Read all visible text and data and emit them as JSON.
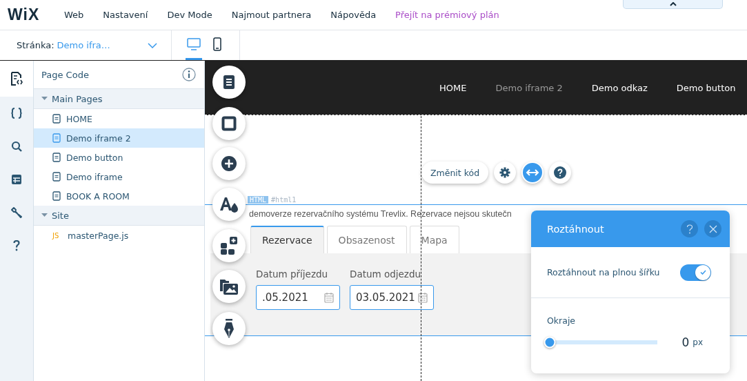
{
  "menu_bar": {
    "logo": "WiX",
    "items": [
      {
        "label": "Web",
        "kind": "normal"
      },
      {
        "label": "Nastavení",
        "kind": "normal"
      },
      {
        "label": "Dev Mode",
        "kind": "normal"
      },
      {
        "label": "Najmout partnera",
        "kind": "normal"
      },
      {
        "label": "Nápověda",
        "kind": "normal"
      },
      {
        "label": "Přejít na prémiový plán",
        "kind": "premium"
      }
    ]
  },
  "page_bar": {
    "label": "Stránka:",
    "page": "Demo ifra…",
    "views": [
      {
        "kind": "desktop",
        "selected": true
      },
      {
        "kind": "mobile",
        "selected": false
      }
    ]
  },
  "side_rail": [
    {
      "kind": "page-code",
      "selected": true
    },
    {
      "kind": "braces",
      "selected": false
    },
    {
      "kind": "search",
      "selected": false
    },
    {
      "kind": "database",
      "selected": false
    },
    {
      "kind": "tools",
      "selected": false
    },
    {
      "kind": "help",
      "selected": false
    }
  ],
  "code_panel": {
    "title": "Page Code",
    "sections": [
      {
        "label": "Main Pages",
        "expanded": true,
        "children": [
          {
            "label": "HOME",
            "kind": "page",
            "selected": false
          },
          {
            "label": "Demo iframe 2",
            "kind": "page",
            "selected": true
          },
          {
            "label": "Demo button",
            "kind": "page",
            "selected": false
          },
          {
            "label": "Demo iframe",
            "kind": "page",
            "selected": false
          },
          {
            "label": "BOOK A ROOM",
            "kind": "page",
            "selected": false
          }
        ]
      },
      {
        "label": "Site",
        "expanded": true,
        "children": [
          {
            "label": "masterPage.js",
            "kind": "js",
            "badge": "JS",
            "selected": false
          }
        ]
      }
    ]
  },
  "canvas": {
    "site_nav": [
      {
        "label": "HOME",
        "selected": false
      },
      {
        "label": "Demo iframe 2",
        "selected": true
      },
      {
        "label": "Demo odkaz",
        "selected": false
      },
      {
        "label": "Demo button",
        "selected": false
      }
    ],
    "tool_buttons": [
      {
        "kind": "pages"
      },
      {
        "kind": "box"
      },
      {
        "kind": "add"
      },
      {
        "kind": "design"
      },
      {
        "kind": "apps"
      },
      {
        "kind": "media"
      },
      {
        "kind": "pen"
      }
    ],
    "element_toolbar": {
      "edit_code": "Změnit kód",
      "buttons": [
        {
          "kind": "settings",
          "selected": false
        },
        {
          "kind": "stretch",
          "selected": true
        },
        {
          "kind": "help",
          "selected": false
        }
      ]
    },
    "element_label": {
      "type": "HTML",
      "id": "#html1"
    },
    "html_embed": {
      "intro": "demoverze rezervačního systému Trevlix. Rezervace nejsou skutečn",
      "tabs": [
        {
          "label": "Rezervace",
          "selected": true
        },
        {
          "label": "Obsazenost",
          "selected": false
        },
        {
          "label": "Mapa",
          "selected": false
        }
      ],
      "fields": [
        {
          "label": "Datum příjezdu",
          "value": ".05.2021"
        },
        {
          "label": "Datum odjezdu",
          "value": "03.05.2021"
        }
      ]
    }
  },
  "stretch_panel": {
    "title": "Roztáhnout",
    "full_width": {
      "label": "Roztáhnout na plnou šířku",
      "on": true
    },
    "margins": {
      "label": "Okraje",
      "level": 0,
      "value": "0",
      "unit": "px"
    }
  }
}
